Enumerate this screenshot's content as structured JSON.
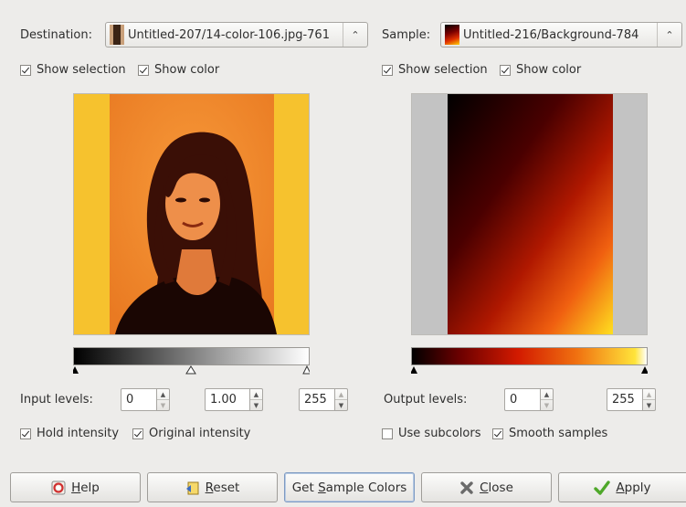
{
  "destination": {
    "label": "Destination:",
    "value": "Untitled-207/14-color-106.jpg-761",
    "show_selection": {
      "label": "Show selection",
      "checked": true
    },
    "show_color": {
      "label": "Show color",
      "checked": true
    }
  },
  "sample": {
    "label": "Sample:",
    "value": "Untitled-216/Background-784",
    "show_selection": {
      "label": "Show selection",
      "checked": true
    },
    "show_color": {
      "label": "Show color",
      "checked": true
    }
  },
  "input_levels": {
    "label": "Input levels:",
    "low": "0",
    "gamma": "1.00",
    "high": "255"
  },
  "output_levels": {
    "label": "Output levels:",
    "low": "0",
    "high": "255"
  },
  "options": {
    "hold_intensity": {
      "label": "Hold intensity",
      "checked": true
    },
    "original_intensity": {
      "label": "Original intensity",
      "checked": true
    },
    "use_subcolors": {
      "label": "Use subcolors",
      "checked": false
    },
    "smooth_samples": {
      "label": "Smooth samples",
      "checked": true
    }
  },
  "buttons": {
    "help": {
      "pre": "",
      "mn": "H",
      "post": "elp"
    },
    "reset": {
      "pre": "",
      "mn": "R",
      "post": "eset"
    },
    "get_sample_colors": {
      "pre": "Get ",
      "mn": "S",
      "post": "ample Colors"
    },
    "close": {
      "pre": "",
      "mn": "C",
      "post": "lose"
    },
    "apply": {
      "pre": "",
      "mn": "A",
      "post": "pply"
    }
  },
  "colors": {
    "background": "#edecea",
    "portrait_orange": "#f08a2a",
    "portrait_yellow": "#f6c22e",
    "sample_grey": "#c3c3c3"
  }
}
